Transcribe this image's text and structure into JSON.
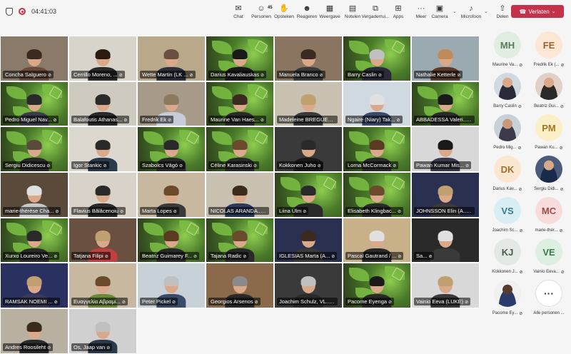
{
  "topbar": {
    "timer": "04:41:03",
    "buttons": [
      {
        "label": "Chat",
        "icon": "chat-icon",
        "glyph": "✉"
      },
      {
        "label": "Personen",
        "icon": "people-icon",
        "glyph": "☺",
        "badge": "45"
      },
      {
        "label": "Opsteken",
        "icon": "raise-hand-icon",
        "glyph": "✋"
      },
      {
        "label": "Reageren",
        "icon": "react-icon",
        "glyph": "☻"
      },
      {
        "label": "Weergave",
        "icon": "view-icon",
        "glyph": "▦"
      },
      {
        "label": "Notulen",
        "icon": "notes-icon",
        "glyph": "▤"
      },
      {
        "label": "Vergaderrui...",
        "icon": "breakout-icon",
        "glyph": "⧉"
      },
      {
        "label": "Apps",
        "icon": "apps-icon",
        "glyph": "⊞"
      },
      {
        "label": "Meer",
        "icon": "more-icon",
        "glyph": "···"
      }
    ],
    "camera_label": "Camera",
    "mic_label": "Microfoon",
    "share_label": "Delen",
    "leave_label": "Verlaten"
  },
  "tiles": [
    {
      "name": "Concha Salguero",
      "bg": "#8a7a6a",
      "shirt": "#6a4a3a",
      "hair": "#3a2a20",
      "green": false
    },
    {
      "name": "Cerrillo Moreno, ...",
      "bg": "#d8d4cc",
      "shirt": "#2a2a2a",
      "hair": "#2a1a10",
      "green": false
    },
    {
      "name": "Wette Martin (LK ...",
      "bg": "#b9a889",
      "shirt": "#2a2f3a",
      "hair": "#6a5040",
      "green": false
    },
    {
      "name": "Darius Kavaliauskas",
      "bg": "#3a4a2a",
      "shirt": "#1a1a1a",
      "hair": "#1a1a1a",
      "green": true
    },
    {
      "name": "Manuela Branco",
      "bg": "#8a7560",
      "shirt": "#3a3a3a",
      "hair": "#3a2a20",
      "green": false
    },
    {
      "name": "Barry  Caslin",
      "bg": "#3a4a2a",
      "shirt": "#2a2a3a",
      "hair": "#c0c0c0",
      "green": true
    },
    {
      "name": "Nathalie Ketterle",
      "bg": "#9aaab0",
      "shirt": "#5a3a2a",
      "hair": "#c08a5a",
      "green": false
    },
    {
      "name": "Pedro  Miguel Nav...",
      "bg": "#3a4a2a",
      "shirt": "#3a3a4a",
      "hair": "#2a2a2a",
      "green": true
    },
    {
      "name": "Balafoutis Athanas...",
      "bg": "#cfcac0",
      "shirt": "#2a2a2a",
      "hair": "#2a2a2a",
      "green": false
    },
    {
      "name": "Fredrik Ek",
      "bg": "#a89a88",
      "shirt": "#c8ccd8",
      "hair": "#8a7a60",
      "green": false
    },
    {
      "name": "Maurine Van Haes...",
      "bg": "#3a4a2a",
      "shirt": "#2a2a2a",
      "hair": "#3a2a20",
      "green": true
    },
    {
      "name": "Madeleine BREGUET",
      "bg": "#c8c0b0",
      "shirt": "#3a3a3a",
      "hair": "#c0a070",
      "green": false
    },
    {
      "name": "Ngaire (Niary) Tak...",
      "bg": "#d0d8e0",
      "shirt": "#3a4a6a",
      "hair": "#e0e0e0",
      "green": false
    },
    {
      "name": "ABBADESSA Valeri...",
      "bg": "#7bbf43",
      "shirt": "#2a2a2a",
      "hair": "#1a1a1a",
      "green": true
    },
    {
      "name": "Sergiu Didicescu",
      "bg": "#3a4a2a",
      "shirt": "#2a2a2a",
      "hair": "#5a4a3a",
      "green": true
    },
    {
      "name": "Igor Stankic",
      "bg": "#dcd8d0",
      "shirt": "#2a3a4a",
      "hair": "#2a2a2a",
      "green": false
    },
    {
      "name": "Szabolcs Vágó",
      "bg": "#3a4a2a",
      "shirt": "#2a2a2a",
      "hair": "#2a2a2a",
      "green": true
    },
    {
      "name": "Céline Karasinski",
      "bg": "#3a4a2a",
      "shirt": "#2a2a2a",
      "hair": "#6a4a2a",
      "green": true
    },
    {
      "name": "Kokkonen Juho",
      "bg": "#3a3a3a",
      "shirt": "#1a1a1a",
      "hair": "#2a2a2a",
      "green": false
    },
    {
      "name": "Lorna McCormack",
      "bg": "#3a4a2a",
      "shirt": "#2a2a2a",
      "hair": "#5a3a20",
      "green": true
    },
    {
      "name": "Pawan Kumar Mis...",
      "bg": "#d8d8d8",
      "shirt": "#3a3a4a",
      "hair": "#1a1a1a",
      "green": false
    },
    {
      "name": "marie-thérèse Cha...",
      "bg": "#5a4a3a",
      "shirt": "#c8c8c8",
      "hair": "#e0e0e0",
      "green": false
    },
    {
      "name": "Flavius Bălăcenoiu",
      "bg": "#d8d2c8",
      "shirt": "#2a2a2a",
      "hair": "#2a2a2a",
      "green": false
    },
    {
      "name": "Marta Lopes",
      "bg": "#c8b8a0",
      "shirt": "#3a3a3a",
      "hair": "#6a4a2a",
      "green": false
    },
    {
      "name": "NICOLAS ARANDA...",
      "bg": "#c8c0b0",
      "shirt": "#2a3a5a",
      "hair": "#3a2a20",
      "green": false
    },
    {
      "name": "Liina  Ulm",
      "bg": "#3a4a2a",
      "shirt": "#2a2a2a",
      "hair": "#2a2a2a",
      "green": true
    },
    {
      "name": "Elisabeth  Klingbac...",
      "bg": "#3a4a2a",
      "shirt": "#2a2a2a",
      "hair": "#6a4a2a",
      "green": true
    },
    {
      "name": "JOHNSSON Elin (A...",
      "bg": "#2a3050",
      "shirt": "#3a3a3a",
      "hair": "#c0a070",
      "green": false
    },
    {
      "name": "Xurxo  Loureiro Ve...",
      "bg": "#3a4a2a",
      "shirt": "#2a2a2a",
      "hair": "#2a2a2a",
      "green": true
    },
    {
      "name": "Tatjana Filipi",
      "bg": "#6a5040",
      "shirt": "#c04040",
      "hair": "#c0a070",
      "green": false
    },
    {
      "name": "Beatriz Guimarey F...",
      "bg": "#3a4a2a",
      "shirt": "#2a2a2a",
      "hair": "#5a3a20",
      "green": true
    },
    {
      "name": "Tajana Radic",
      "bg": "#3a4a2a",
      "shirt": "#2a2a2a",
      "hair": "#6a4a2a",
      "green": true
    },
    {
      "name": "IGLESIAS Marta (A...",
      "bg": "#2a3050",
      "shirt": "#3a3a3a",
      "hair": "#3a2a20",
      "green": false
    },
    {
      "name": "Pascal Gautrand / ...",
      "bg": "#c8b088",
      "shirt": "#2a2a2a",
      "hair": "#e0e0e0",
      "green": false
    },
    {
      "name": "Sa...",
      "bg": "#2a2a2a",
      "shirt": "#3a3a3a",
      "hair": "#e0e0e0",
      "green": false
    },
    {
      "name": "RAMSAK NOEMI ...",
      "bg": "#2a3060",
      "shirt": "#3a3a5a",
      "hair": "#c0a070",
      "green": false
    },
    {
      "name": "Ευαγγελία Αβραμί...",
      "bg": "#c8b8a0",
      "shirt": "#6a8a3a",
      "hair": "#6a4a2a",
      "green": false
    },
    {
      "name": "Peter Pickel",
      "bg": "#c8d0d8",
      "shirt": "#3a4a6a",
      "hair": "#c0c0c0",
      "green": false
    },
    {
      "name": "Georgios Arsenos",
      "bg": "#8a6a4a",
      "shirt": "#2a2a2a",
      "hair": "#8a8a8a",
      "green": false
    },
    {
      "name": "Joachim Schulz, VL...",
      "bg": "#3a3a3a",
      "shirt": "#2a2a2a",
      "hair": "#c0c0c0",
      "green": false
    },
    {
      "name": "Pacome Eyenga",
      "bg": "#3a4a2a",
      "shirt": "#2a2a2a",
      "hair": "#1a1a1a",
      "green": true
    },
    {
      "name": "Vainio Eeva (LUKE)",
      "bg": "#d8d8d8",
      "shirt": "#3a3a3a",
      "hair": "#c0a070",
      "green": false
    },
    {
      "name": "Andres Roosileht",
      "bg": "#b8b0a0",
      "shirt": "#2a2a2a",
      "hair": "#3a2a20",
      "green": false
    },
    {
      "name": "Os, Jaap van",
      "bg": "#d0d0d0",
      "shirt": "#2a3a4a",
      "hair": "#c0c0c0",
      "green": false
    }
  ],
  "side_participants": [
    {
      "initials": "MH",
      "name": "Maurine Va...",
      "color": "#dfeee0",
      "fg": "#5a7a5a",
      "photo": false
    },
    {
      "initials": "FE",
      "name": "Fredrik Ek (...",
      "color": "#fbe7d4",
      "fg": "#a0602a",
      "photo": false
    },
    {
      "initials": "",
      "name": "Barry Caslin",
      "color": "#d0d8e0",
      "fg": "#333",
      "photo": true,
      "skin": "#d9a98a",
      "shirt": "#2a2a3a"
    },
    {
      "initials": "",
      "name": "Beatriz Gui...",
      "color": "#e0d0c8",
      "fg": "#333",
      "photo": true,
      "skin": "#d9a98a",
      "shirt": "#2a2a2a"
    },
    {
      "initials": "",
      "name": "Pedro Mig...",
      "color": "#c8d0d8",
      "fg": "#333",
      "photo": true,
      "skin": "#c89878",
      "shirt": "#3a3a4a"
    },
    {
      "initials": "PM",
      "name": "Pawan Ku...",
      "color": "#fbefc8",
      "fg": "#9a7a20",
      "photo": false
    },
    {
      "initials": "DK",
      "name": "Darius Kav...",
      "color": "#fbe7d0",
      "fg": "#a0702a",
      "photo": false
    },
    {
      "initials": "",
      "name": "Sergiu Didi...",
      "color": "#4a5a7a",
      "fg": "#fff",
      "photo": true,
      "skin": "#d9a98a",
      "shirt": "#1a2a4a"
    },
    {
      "initials": "VS",
      "name": "Joachim Sc...",
      "color": "#d8eef4",
      "fg": "#3a7a8a",
      "photo": false
    },
    {
      "initials": "MC",
      "name": "marie-thér...",
      "color": "#f8dcdc",
      "fg": "#a04a4a",
      "photo": false
    },
    {
      "initials": "KJ",
      "name": "Kokkonen J...",
      "color": "#e4e8e4",
      "fg": "#4a5a4a",
      "photo": false
    },
    {
      "initials": "VE",
      "name": "Vainio Eeva...",
      "color": "#dcefe0",
      "fg": "#3a7a4a",
      "photo": false
    },
    {
      "initials": "",
      "name": "Pacome Ey...",
      "color": "#f0f0f0",
      "fg": "#333",
      "photo": true,
      "skin": "#5a3a2a",
      "shirt": "#2a3a6a"
    },
    {
      "initials": "",
      "name": "Alle personen ...",
      "color": "#ffffff",
      "fg": "#333",
      "photo": false,
      "more": true
    }
  ]
}
